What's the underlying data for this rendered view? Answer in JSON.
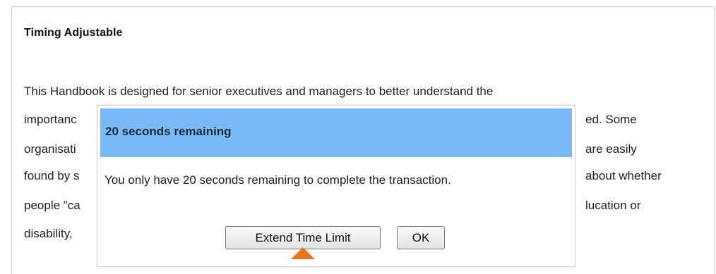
{
  "page": {
    "heading": "Timing Adjustable",
    "lines_left": [
      "This Handbook is designed for senior executives and managers to better understand the",
      "importanc",
      "organisati",
      "found by s",
      "people \"ca",
      "disability,"
    ],
    "lines_right": [
      "ed. Some",
      "are easily",
      "about whether",
      "lucation or"
    ]
  },
  "dialog": {
    "title": "20 seconds remaining",
    "message": "You only have 20 seconds remaining to complete the transaction.",
    "extend_button_label": "Extend Time Limit",
    "ok_button_label": "OK",
    "header_color": "#79b9f5"
  },
  "annotation": {
    "arrow_color": "#e8761d"
  }
}
